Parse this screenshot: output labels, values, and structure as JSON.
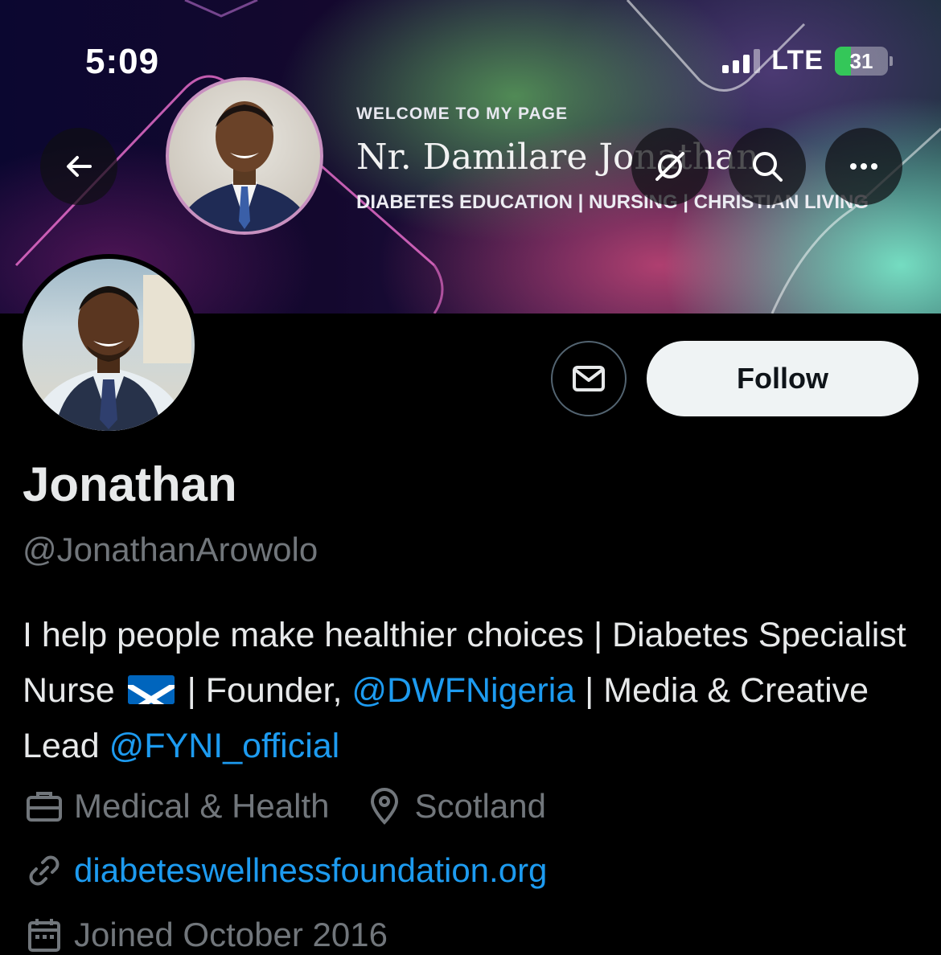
{
  "status_bar": {
    "time": "5:09",
    "network": "LTE",
    "battery": "31",
    "battery_level_percent": 31
  },
  "banner": {
    "welcome": "WELCOME TO MY PAGE",
    "name": "Nr. Damilare Jonathan",
    "tagline": "DIABETES EDUCATION | NURSING | CHRISTIAN LIVING"
  },
  "nav": {
    "back_icon": "arrow-left-icon",
    "grok_icon": "slashed-circle-icon",
    "search_icon": "search-icon",
    "more_icon": "more-horizontal-icon"
  },
  "profile": {
    "display_name": "Jonathan",
    "handle": "@JonathanArowolo",
    "follow_label": "Follow",
    "message_icon": "mail-icon",
    "bio": {
      "part1": "I help people make healthier choices | Diabetes Specialist Nurse ",
      "flag": "scotland-flag",
      "part2": " | Founder, ",
      "mention1": "@DWFNigeria",
      "part3": " | Media & Creative Lead ",
      "mention2": "@FYNI_official"
    },
    "category": "Medical & Health",
    "location": "Scotland",
    "website": "diabeteswellnessfoundation.org",
    "joined": "Joined October 2016"
  },
  "colors": {
    "accent_link": "#1d9bf0",
    "muted_text": "#71767b",
    "follow_bg": "#eff3f4"
  }
}
